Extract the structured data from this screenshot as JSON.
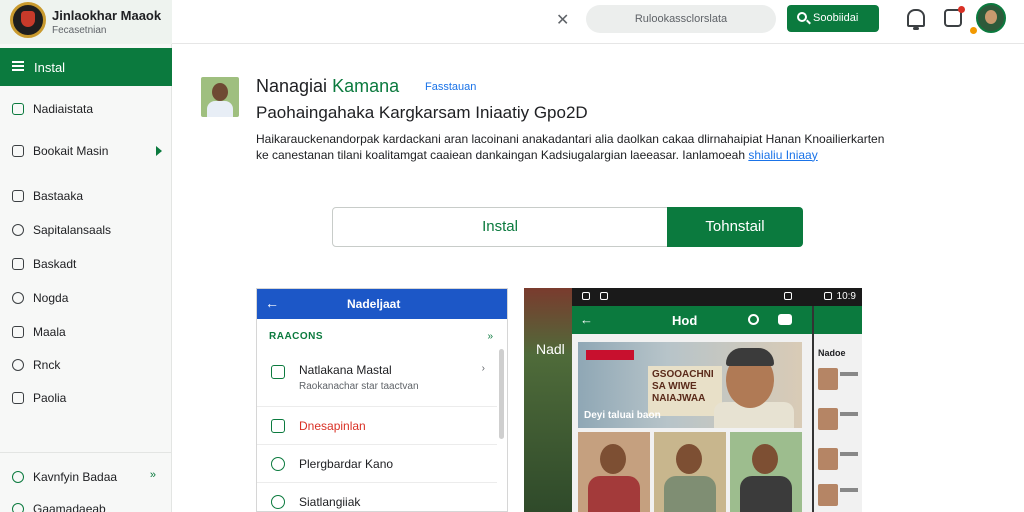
{
  "brand": {
    "title": "Jinlaokhar Maaok",
    "subtitle": "Fecasetnian"
  },
  "sidebar": {
    "active": {
      "label": "Instal"
    },
    "items": [
      {
        "label": "Nadiaistata",
        "icon": "home-icon"
      },
      {
        "label": "Bookait Masin",
        "icon": "bookmark-icon"
      },
      {
        "label": "Bastaaka",
        "icon": "bag-icon"
      },
      {
        "label": "Sapitalansaals",
        "icon": "settings-icon"
      },
      {
        "label": "Baskadt",
        "icon": "cart-icon"
      },
      {
        "label": "Nogda",
        "icon": "shield-icon"
      },
      {
        "label": "Maala",
        "icon": "mail-icon"
      },
      {
        "label": "Rnck",
        "icon": "circle-icon"
      },
      {
        "label": "Paolia",
        "icon": "document-icon"
      }
    ],
    "footer": [
      {
        "label": "Kavnfyin Badaa",
        "more": "»"
      },
      {
        "label": "Gaamadaeab"
      }
    ]
  },
  "topbar": {
    "search_placeholder": "Rulookassclorslata",
    "search_button": "Soobiidai"
  },
  "app": {
    "name_part1": "Nanagiai",
    "name_part2": "Kamana",
    "tag": "Fasstauan",
    "subtitle": "Paohaingahaka Kargkarsam Iniaatiy Gpo2D",
    "description": "Haikarauckenandorpak kardackani aran lacoinani anakadantari alia daolkan cakaa dlirnahaipiat Hanan Knoailierkarten ke canestanan tilani koalitamgat caaiean dankaingan Kadsiugalargian laeeasar. Ianlamoeah",
    "description_link": "shialiu Iniaay",
    "install_button": "Instal",
    "primary_button": "Tohnstail"
  },
  "screenshot1": {
    "bar_title": "Nadeljaat",
    "section": "RAACONS",
    "section_more": "»",
    "rows": [
      {
        "title": "Natlakana Mastal",
        "sub": "Raokanachar star taactvan",
        "red": false
      },
      {
        "title": "Dnesapinlan",
        "sub": "",
        "red": true
      },
      {
        "title": "Plergbardar Kano",
        "sub": "",
        "red": false
      },
      {
        "title": "Siatlangiiak",
        "sub": "",
        "red": false
      }
    ]
  },
  "screenshot2": {
    "left_text": "Nadl",
    "status_time": "10:9",
    "bar_title": "Hod",
    "hero_sign": "GSOOACHNI SA WIWE NAIAJWAA",
    "hero_tagline": "Deyi taluai baon",
    "right_title": "Nadoe"
  }
}
